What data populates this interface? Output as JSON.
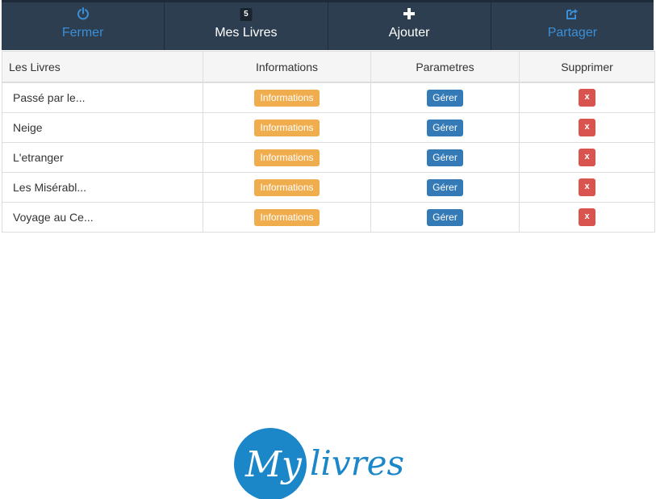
{
  "nav": {
    "items": [
      {
        "label": "Fermer",
        "icon": "power-icon"
      },
      {
        "label": "Mes Livres",
        "badge": "5"
      },
      {
        "label": "Ajouter",
        "icon": "plus-icon"
      },
      {
        "label": "Partager",
        "icon": "share-icon"
      }
    ]
  },
  "table": {
    "headers": [
      "Les Livres",
      "Informations",
      "Parametres",
      "Supprimer"
    ],
    "rows": [
      {
        "title": "Passé par le...",
        "info_label": "Informations",
        "manage_label": "Gérer",
        "delete_label": "x"
      },
      {
        "title": "Neige",
        "info_label": "Informations",
        "manage_label": "Gérer",
        "delete_label": "x"
      },
      {
        "title": "L'etranger",
        "info_label": "Informations",
        "manage_label": "Gérer",
        "delete_label": "x"
      },
      {
        "title": "Les Misérabl...",
        "info_label": "Informations",
        "manage_label": "Gérer",
        "delete_label": "x"
      },
      {
        "title": "Voyage au Ce...",
        "info_label": "Informations",
        "manage_label": "Gérer",
        "delete_label": "x"
      }
    ]
  },
  "logo": {
    "text_my": "My",
    "text_livres": "livres"
  },
  "colors": {
    "navbar_bg": "#2c3e50",
    "nav_muted": "#3b8fd8",
    "info_button": "#f0ad4e",
    "manage_button": "#337ab7",
    "delete_button": "#d9534f",
    "logo_blue": "#1b86c8"
  }
}
